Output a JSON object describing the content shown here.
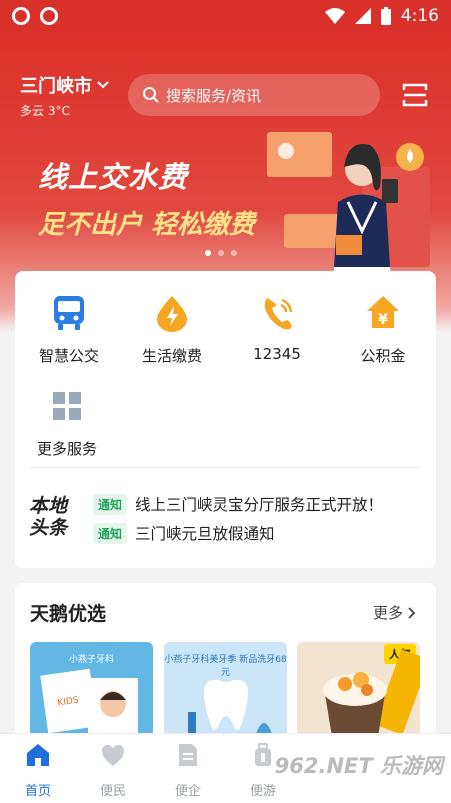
{
  "status_bar": {
    "time": "4:16"
  },
  "header": {
    "city": "三门峡市",
    "weather": "多云 3°C",
    "search_placeholder": "搜索服务/资讯"
  },
  "banner": {
    "title": "线上交水费",
    "subtitle": "足不出户 轻松缴费",
    "active_dot": 0,
    "dot_count": 3
  },
  "services": [
    {
      "label": "智慧公交",
      "icon": "bus-icon",
      "color": "#2a7de1"
    },
    {
      "label": "生活缴费",
      "icon": "water-drop-icon",
      "color": "#f5a623"
    },
    {
      "label": "12345",
      "icon": "phone-icon",
      "color": "#f5a623"
    },
    {
      "label": "公积金",
      "icon": "house-icon",
      "color": "#f5a623"
    },
    {
      "label": "更多服务",
      "icon": "grid-icon",
      "color": "#9aa8bb"
    }
  ],
  "news": {
    "logo_line1": "本地",
    "logo_line2": "头条",
    "items": [
      {
        "tag": "通知",
        "text": "线上三门峡灵宝分厅服务正式开放！"
      },
      {
        "tag": "通知",
        "text": "三门峡元旦放假通知"
      }
    ]
  },
  "featured": {
    "title": "天鹅优选",
    "more": "更多",
    "cards": [
      {
        "caption": "小燕子牙科"
      },
      {
        "caption": "小燕子牙科美牙季 新品洗牙68元"
      },
      {
        "badge": "人气"
      }
    ]
  },
  "tabbar": {
    "tabs": [
      {
        "label": "首页",
        "active": true
      },
      {
        "label": "便民",
        "active": false
      },
      {
        "label": "便企",
        "active": false
      },
      {
        "label": "便游",
        "active": false
      }
    ],
    "watermark": "962.NET 乐游网"
  },
  "colors": {
    "brand_red": "#dc3028",
    "accent_blue": "#1e6fd9",
    "tag_green": "#23a35a"
  }
}
